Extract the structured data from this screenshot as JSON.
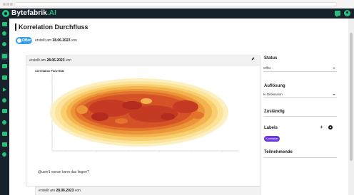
{
  "app": {
    "brand_main": "Bytefabrik",
    "brand_suffix": ".AI"
  },
  "page": {
    "title": "Korrelation Durchfluss",
    "status_label": "Offen",
    "created_prefix": "erstellt am",
    "created_date": "28.06.2023",
    "created_suffix": "von"
  },
  "post": {
    "created_prefix": "erstellt am",
    "created_date": "28.06.2023",
    "created_suffix": "von",
    "chart_title": "Correlation Flow Rate",
    "comment": "@user1 woran kann das liegen?"
  },
  "post2": {
    "created_prefix": "erstellt am",
    "created_date": "28.06.2023",
    "created_suffix": "von"
  },
  "panel": {
    "status_label": "Status",
    "status_value": "Offen",
    "resolution_label": "Auflösung",
    "resolution_value": "In Diskussion",
    "assignee_label": "Zuständig",
    "labels_label": "Labels",
    "label_chip": "Korrelation",
    "participants_label": "Teilnehmende"
  },
  "colors": {
    "brand_green": "#27c07a",
    "sidebar_bg": "#17222c",
    "status_blue": "#3aa0e8",
    "chip_purple": "#6b35e8"
  },
  "icons": [
    "chat-icon",
    "user-icon",
    "edit-icon",
    "plus-icon",
    "gear-icon"
  ]
}
